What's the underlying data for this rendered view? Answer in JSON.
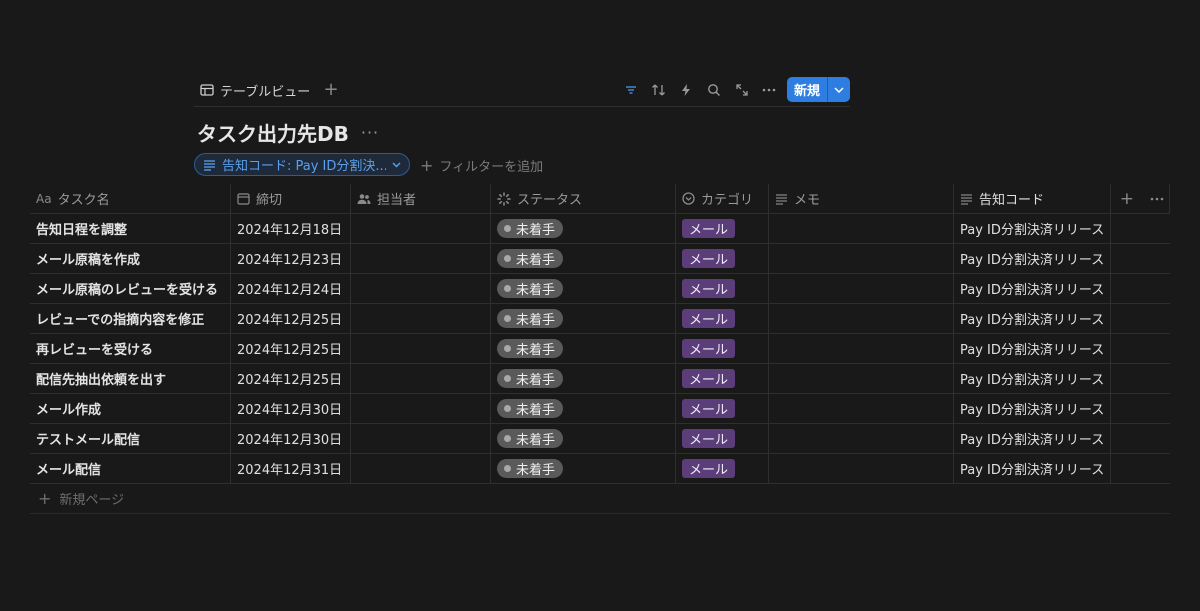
{
  "toolbar": {
    "view_tab_label": "テーブルビュー",
    "add_view_label": "+",
    "new_button_label": "新規"
  },
  "database": {
    "title": "タスク出力先DB",
    "more_label": "···"
  },
  "filter": {
    "chip_label": "告知コード: Pay ID分割決...",
    "add_filter_label": "フィルターを追加"
  },
  "columns": [
    {
      "prefix": "Aa",
      "label": "タスク名",
      "icon": "title-icon"
    },
    {
      "label": "締切",
      "icon": "calendar-icon"
    },
    {
      "label": "担当者",
      "icon": "people-icon"
    },
    {
      "label": "ステータス",
      "icon": "status-icon"
    },
    {
      "label": "カテゴリ",
      "icon": "select-icon"
    },
    {
      "label": "メモ",
      "icon": "text-icon"
    },
    {
      "label": "告知コード",
      "icon": "text-icon"
    }
  ],
  "rows": [
    {
      "title": "告知日程を調整",
      "deadline": "2024年12月18日",
      "status": "未着手",
      "category": "メール",
      "code": "Pay ID分割決済リリース"
    },
    {
      "title": "メール原稿を作成",
      "deadline": "2024年12月23日",
      "status": "未着手",
      "category": "メール",
      "code": "Pay ID分割決済リリース"
    },
    {
      "title": "メール原稿のレビューを受ける",
      "deadline": "2024年12月24日",
      "status": "未着手",
      "category": "メール",
      "code": "Pay ID分割決済リリース"
    },
    {
      "title": "レビューでの指摘内容を修正",
      "deadline": "2024年12月25日",
      "status": "未着手",
      "category": "メール",
      "code": "Pay ID分割決済リリース"
    },
    {
      "title": "再レビューを受ける",
      "deadline": "2024年12月25日",
      "status": "未着手",
      "category": "メール",
      "code": "Pay ID分割決済リリース"
    },
    {
      "title": "配信先抽出依頼を出す",
      "deadline": "2024年12月25日",
      "status": "未着手",
      "category": "メール",
      "code": "Pay ID分割決済リリース"
    },
    {
      "title": "メール作成",
      "deadline": "2024年12月30日",
      "status": "未着手",
      "category": "メール",
      "code": "Pay ID分割決済リリース"
    },
    {
      "title": "テストメール配信",
      "deadline": "2024年12月30日",
      "status": "未着手",
      "category": "メール",
      "code": "Pay ID分割決済リリース"
    },
    {
      "title": "メール配信",
      "deadline": "2024年12月31日",
      "status": "未着手",
      "category": "メール",
      "code": "Pay ID分割決済リリース"
    }
  ],
  "new_page_label": "新規ページ",
  "colors": {
    "accent": "#2d7ee0",
    "category_tag": "#5b3d7a",
    "status_pill": "#5a5a5a",
    "background": "#191919"
  }
}
